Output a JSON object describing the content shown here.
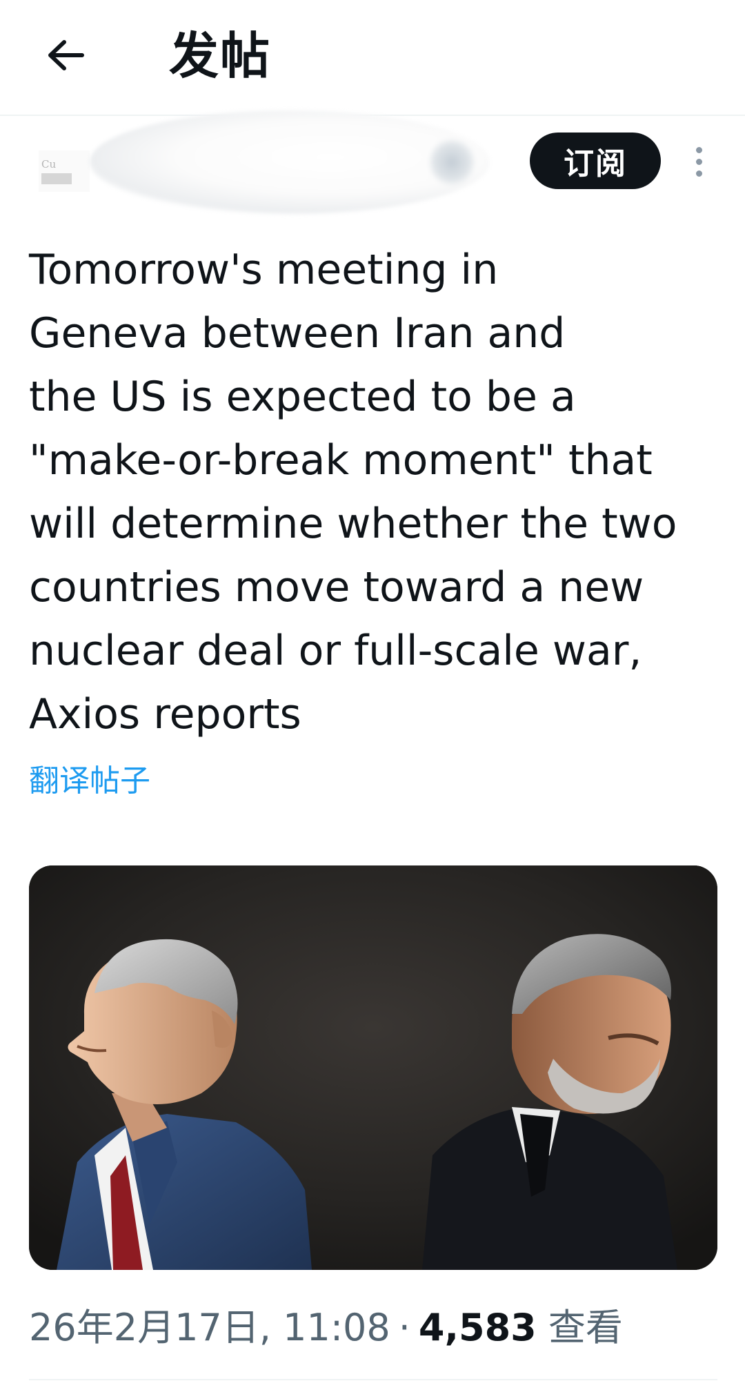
{
  "header": {
    "title": "发帖",
    "back_icon": "arrow-left-icon"
  },
  "author": {
    "subscribe_label": "订阅",
    "more_icon": "more-vertical-icon"
  },
  "post": {
    "text": "Tomorrow's meeting in Geneva between Iran and the US is expected to be a \"make-or-break moment\" that will determine whether the two countries move toward a new nuclear deal or full-scale war, Axios reports",
    "lines": [
      "Tomorrow's meeting in",
      "Geneva between Iran and",
      "the US is expected to be a",
      "\"make-or-break moment\" that",
      "will determine whether the two",
      "countries move toward a new",
      "nuclear deal or full-scale war,",
      "Axios reports"
    ],
    "translate_label": "翻译帖子"
  },
  "media": {
    "type": "photo"
  },
  "meta": {
    "datetime": "26年2月17日, 11:08",
    "separator": "·",
    "views_count": "4,583",
    "views_label": "查看"
  },
  "colors": {
    "accent": "#1d9bf0",
    "text_primary": "#0f1419",
    "text_secondary": "#536471",
    "button_bg": "#0f1419"
  }
}
